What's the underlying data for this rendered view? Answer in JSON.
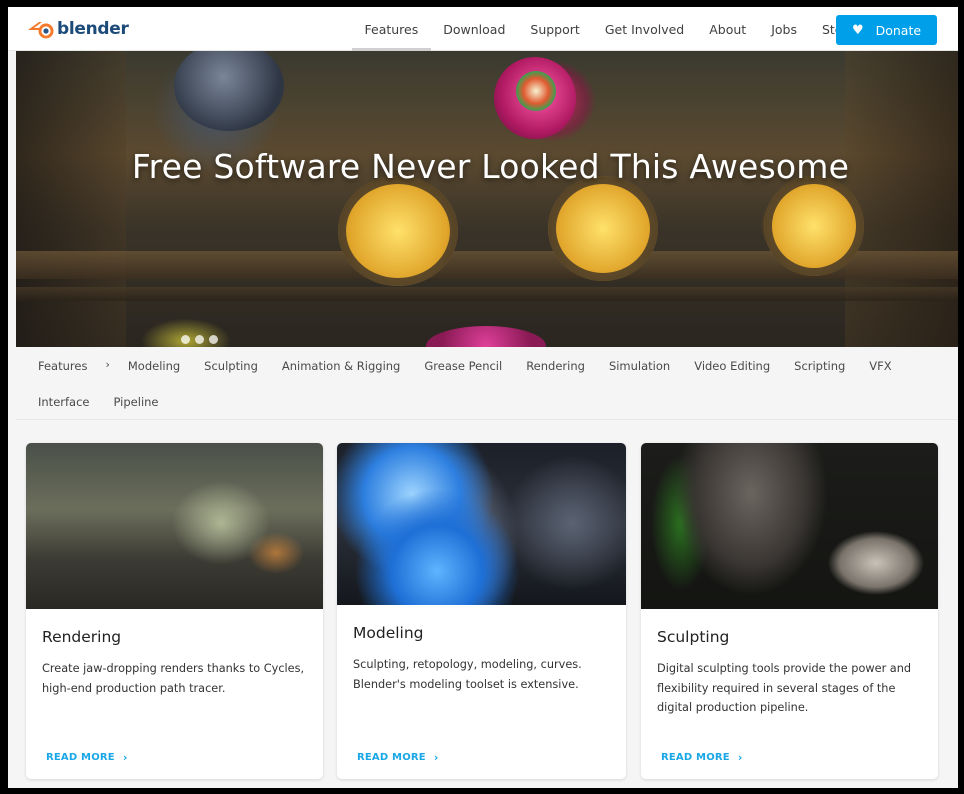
{
  "brand": {
    "name": "blender",
    "logo_icon": "blender-logo-icon"
  },
  "nav": {
    "items": [
      {
        "label": "Features",
        "active": true
      },
      {
        "label": "Download",
        "active": false
      },
      {
        "label": "Support",
        "active": false
      },
      {
        "label": "Get Involved",
        "active": false
      },
      {
        "label": "About",
        "active": false
      },
      {
        "label": "Jobs",
        "active": false
      },
      {
        "label": "Store",
        "active": false
      }
    ],
    "donate": {
      "label": "Donate",
      "icon": "heart-icon",
      "color": "#009fe9"
    }
  },
  "hero": {
    "title": "Free Software Never Looked This Awesome",
    "slides": 3
  },
  "subnav": {
    "root": "Features",
    "separator": "›",
    "items_row1": [
      "Modeling",
      "Sculpting",
      "Animation & Rigging",
      "Grease Pencil",
      "Rendering",
      "Simulation",
      "Video Editing",
      "Scripting",
      "VFX"
    ],
    "items_row2": [
      "Interface",
      "Pipeline"
    ]
  },
  "cards": [
    {
      "title": "Rendering",
      "description": "Create jaw-dropping renders thanks to Cycles, high-end production path tracer.",
      "link": "READ MORE"
    },
    {
      "title": "Modeling",
      "description": "Sculpting, retopology, modeling, curves. Blender's modeling toolset is extensive.",
      "link": "READ MORE"
    },
    {
      "title": "Sculpting",
      "description": "Digital sculpting tools provide the power and flexibility required in several stages of the digital production pipeline.",
      "link": "READ MORE"
    }
  ],
  "colors": {
    "accent": "#009fe9",
    "link": "#1aa7e6",
    "brand_text": "#1c4b7a",
    "brand_orange": "#f5792a"
  }
}
